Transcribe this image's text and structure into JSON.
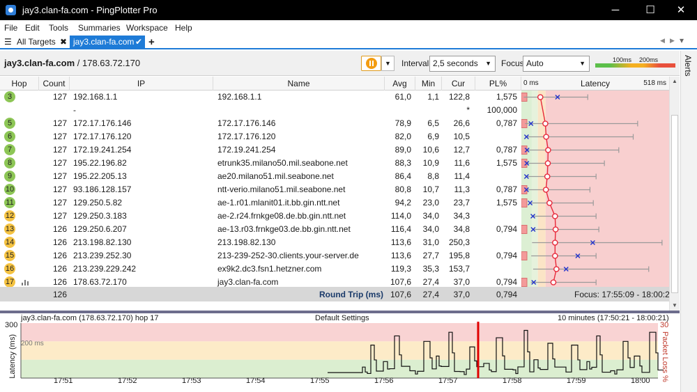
{
  "window": {
    "title": "jay3.clan-fa.com - PingPlotter Pro",
    "minimize": "─",
    "maximize": "☐",
    "close": "✕"
  },
  "menu": [
    "File",
    "Edit",
    "Tools",
    "Summaries",
    "Workspace",
    "Help"
  ],
  "tabs": {
    "all_targets": "All Targets",
    "active": "jay3.clan-fa.com",
    "add": "+"
  },
  "alerts_label": "Alerts",
  "toolbar": {
    "target_name": "jay3.clan-fa.com",
    "target_ip": " / 178.63.72.170",
    "interval_label": "Interval",
    "interval_value": "2,5 seconds",
    "focus_label": "Focus",
    "focus_value": "Auto",
    "scale_100": "100ms",
    "scale_200": "200ms"
  },
  "columns": {
    "hop": "Hop",
    "count": "Count",
    "ip": "IP",
    "name": "Name",
    "avg": "Avg",
    "min": "Min",
    "cur": "Cur",
    "pl": "PL%",
    "latency": "Latency",
    "lat_min": "0 ms",
    "lat_max": "518 ms"
  },
  "colors": {
    "green": "#8dc656",
    "yellow": "#f5c342",
    "orange": "#f3a93a",
    "accent": "#1e7bd7"
  },
  "hops": [
    {
      "hop": "3",
      "count": "127",
      "ip": "192.168.1.1",
      "name": "192.168.1.1",
      "avg": "61,0",
      "min": "1,1",
      "cur": "122,8",
      "pl": "1,575",
      "color": "#8dc656",
      "avg_ms": 61,
      "min_ms": 1,
      "max_ms": 232,
      "cur_ms": 123,
      "pl_pct": 1.575
    },
    {
      "hop": "",
      "count": "",
      "ip": "-",
      "name": "",
      "avg": "",
      "min": "",
      "cur": "*",
      "pl": "100,000",
      "color": "",
      "avg_ms": null,
      "min_ms": null,
      "max_ms": null,
      "cur_ms": null,
      "pl_pct": 100
    },
    {
      "hop": "5",
      "count": "127",
      "ip": "172.17.176.146",
      "name": "172.17.176.146",
      "avg": "78,9",
      "min": "6,5",
      "cur": "26,6",
      "pl": "0,787",
      "color": "#8dc656",
      "avg_ms": 79,
      "min_ms": 6,
      "max_ms": 412,
      "cur_ms": 27,
      "pl_pct": 0.787
    },
    {
      "hop": "6",
      "count": "127",
      "ip": "172.17.176.120",
      "name": "172.17.176.120",
      "avg": "82,0",
      "min": "6,9",
      "cur": "10,5",
      "pl": "",
      "color": "#8dc656",
      "avg_ms": 82,
      "min_ms": 7,
      "max_ms": 396,
      "cur_ms": 11,
      "pl_pct": 0
    },
    {
      "hop": "7",
      "count": "127",
      "ip": "172.19.241.254",
      "name": "172.19.241.254",
      "avg": "89,0",
      "min": "10,6",
      "cur": "12,7",
      "pl": "0,787",
      "color": "#8dc656",
      "avg_ms": 89,
      "min_ms": 11,
      "max_ms": 344,
      "cur_ms": 13,
      "pl_pct": 0.787
    },
    {
      "hop": "8",
      "count": "127",
      "ip": "195.22.196.82",
      "name": "etrunk35.milano50.mil.seabone.net",
      "avg": "88,3",
      "min": "10,9",
      "cur": "11,6",
      "pl": "1,575",
      "color": "#8dc656",
      "avg_ms": 88,
      "min_ms": 11,
      "max_ms": 292,
      "cur_ms": 12,
      "pl_pct": 1.575
    },
    {
      "hop": "9",
      "count": "127",
      "ip": "195.22.205.13",
      "name": "ae20.milano51.mil.seabone.net",
      "avg": "86,4",
      "min": "8,8",
      "cur": "11,4",
      "pl": "",
      "color": "#8dc656",
      "avg_ms": 86,
      "min_ms": 9,
      "max_ms": 262,
      "cur_ms": 11,
      "pl_pct": 0
    },
    {
      "hop": "10",
      "count": "127",
      "ip": "93.186.128.157",
      "name": "ntt-verio.milano51.mil.seabone.net",
      "avg": "80,8",
      "min": "10,7",
      "cur": "11,3",
      "pl": "0,787",
      "color": "#8dc656",
      "avg_ms": 81,
      "min_ms": 11,
      "max_ms": 240,
      "cur_ms": 11,
      "pl_pct": 0.787
    },
    {
      "hop": "11",
      "count": "127",
      "ip": "129.250.5.82",
      "name": "ae-1.r01.mlanit01.it.bb.gin.ntt.net",
      "avg": "94,2",
      "min": "23,0",
      "cur": "23,7",
      "pl": "1,575",
      "color": "#8dc656",
      "avg_ms": 94,
      "min_ms": 23,
      "max_ms": 252,
      "cur_ms": 24,
      "pl_pct": 1.575
    },
    {
      "hop": "12",
      "count": "127",
      "ip": "129.250.3.183",
      "name": "ae-2.r24.frnkge08.de.bb.gin.ntt.net",
      "avg": "114,0",
      "min": "34,0",
      "cur": "34,3",
      "pl": "",
      "color": "#f5c342",
      "avg_ms": 114,
      "min_ms": 34,
      "max_ms": 262,
      "cur_ms": 34,
      "pl_pct": 0
    },
    {
      "hop": "13",
      "count": "126",
      "ip": "129.250.6.207",
      "name": "ae-13.r03.frnkge03.de.bb.gin.ntt.net",
      "avg": "116,4",
      "min": "34,0",
      "cur": "34,8",
      "pl": "0,794",
      "color": "#f5c342",
      "avg_ms": 116,
      "min_ms": 34,
      "max_ms": 272,
      "cur_ms": 35,
      "pl_pct": 0.794
    },
    {
      "hop": "14",
      "count": "126",
      "ip": "213.198.82.130",
      "name": "213.198.82.130",
      "avg": "113,6",
      "min": "31,0",
      "cur": "250,3",
      "pl": "",
      "color": "#f5c342",
      "avg_ms": 114,
      "min_ms": 31,
      "max_ms": 500,
      "cur_ms": 250,
      "pl_pct": 0
    },
    {
      "hop": "15",
      "count": "126",
      "ip": "213.239.252.30",
      "name": "213-239-252-30.clients.your-server.de",
      "avg": "113,6",
      "min": "27,7",
      "cur": "195,8",
      "pl": "0,794",
      "color": "#f5c342",
      "avg_ms": 114,
      "min_ms": 28,
      "max_ms": 262,
      "cur_ms": 196,
      "pl_pct": 0.794
    },
    {
      "hop": "16",
      "count": "126",
      "ip": "213.239.229.242",
      "name": "ex9k2.dc3.fsn1.hetzner.com",
      "avg": "119,3",
      "min": "35,3",
      "cur": "153,7",
      "pl": "",
      "color": "#f5c342",
      "avg_ms": 119,
      "min_ms": 35,
      "max_ms": 452,
      "cur_ms": 154,
      "pl_pct": 0
    },
    {
      "hop": "17",
      "count": "126",
      "ip": "178.63.72.170",
      "name": "jay3.clan-fa.com",
      "avg": "107,6",
      "min": "27,4",
      "cur": "37,0",
      "pl": "0,794",
      "color": "#f5c342",
      "avg_ms": 108,
      "min_ms": 27,
      "max_ms": 262,
      "cur_ms": 37,
      "pl_pct": 0.794
    }
  ],
  "summary": {
    "count": "126",
    "label": "Round Trip (ms)",
    "avg": "107,6",
    "min": "27,4",
    "cur": "37,0",
    "pl": "0,794",
    "focus": "Focus: 17:55:09 - 18:00:21"
  },
  "bottom": {
    "title": "jay3.clan-fa.com (178.63.72.170) hop 17",
    "settings": "Default Settings",
    "range": "10 minutes (17:50:21 - 18:00:21)",
    "y_max": "300",
    "y_mid": "200 ms",
    "y_label": "Latency (ms)",
    "pl_max": "30",
    "pl_label": "Packet Loss %",
    "times": [
      "17:51",
      "17:52",
      "17:53",
      "17:54",
      "17:55",
      "17:56",
      "17:57",
      "17:58",
      "17:59",
      "18:00"
    ]
  }
}
